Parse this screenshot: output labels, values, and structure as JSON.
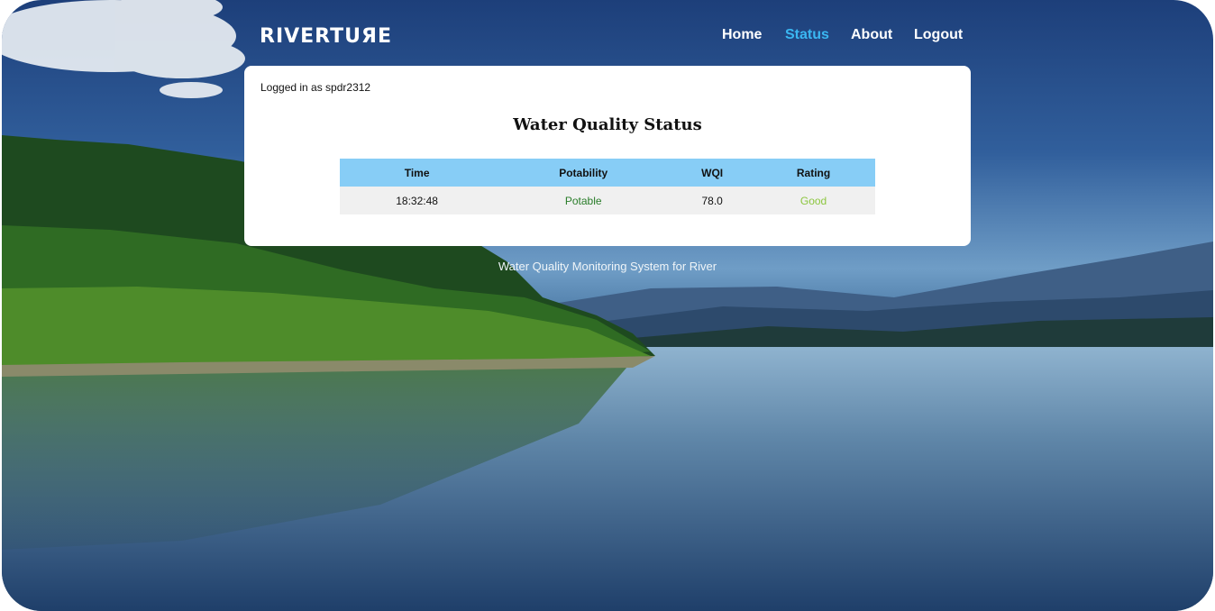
{
  "brand": {
    "logo_text": "RIVERTUЯE"
  },
  "nav": {
    "items": [
      {
        "label": "Home",
        "active": false
      },
      {
        "label": "Status",
        "active": true
      },
      {
        "label": "About",
        "active": false
      },
      {
        "label": "Logout",
        "active": false
      }
    ],
    "active_color": "#3ab7f2"
  },
  "status_card": {
    "logged_in": "Logged in as spdr2312",
    "title": "Water Quality Status",
    "table": {
      "headers": [
        "Time",
        "Potability",
        "WQI",
        "Rating"
      ],
      "rows": [
        {
          "time": "18:32:48",
          "potability": "Potable",
          "wqi": "78.0",
          "rating": "Good"
        }
      ],
      "header_color": "#87cdf6",
      "potable_color": "#2a7d2a",
      "good_color": "#8cc63f"
    }
  },
  "footer": {
    "tagline": "Water Quality Monitoring System for River"
  }
}
